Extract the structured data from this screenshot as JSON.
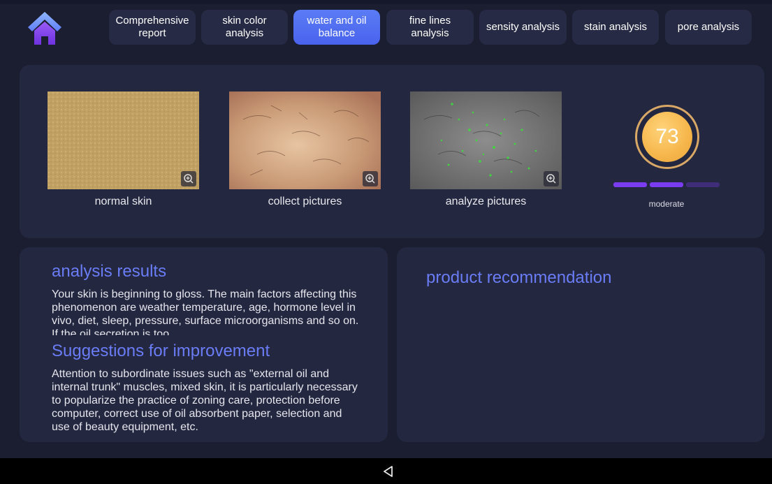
{
  "tabs": [
    {
      "label": "Comprehensive\nreport",
      "active": false
    },
    {
      "label": "skin color\nanalysis",
      "active": false
    },
    {
      "label": "water and oil\nbalance",
      "active": true
    },
    {
      "label": "fine lines\nanalysis",
      "active": false
    },
    {
      "label": "sensity analysis",
      "active": false
    },
    {
      "label": "stain analysis",
      "active": false
    },
    {
      "label": "pore analysis",
      "active": false
    }
  ],
  "images": {
    "normal": {
      "caption": "normal skin"
    },
    "collect": {
      "caption": "collect pictures"
    },
    "analyze": {
      "caption": "analyze pictures"
    }
  },
  "score": {
    "value": "73",
    "level_label": "moderate",
    "level_filled": 2,
    "level_total": 3
  },
  "analysis": {
    "title": "analysis results",
    "text": "Your skin is beginning to gloss. The main factors affecting this phenomenon are weather temperature, age, hormone level in vivo, diet, sleep, pressure, surface microorganisms and so on. If the oil secretion is too"
  },
  "suggestions": {
    "title": "Suggestions for improvement",
    "text": "Attention to subordinate issues such as \"external oil and internal trunk\" muscles, mixed skin, it is particularly necessary to popularize the practice of zoning care, protection before computer, correct use of oil absorbent paper, selection and use of beauty equipment, etc."
  },
  "recommendation": {
    "title": "product recommendation"
  },
  "colors": {
    "background": "#1b1d30",
    "panel": "#23273f",
    "accent": "#6a7cf6",
    "active_tab": "#4f6cf2",
    "level_on": "#7a3cf0",
    "level_off": "#3f2d7a",
    "score": "#f6b64b"
  },
  "icons": {
    "home": "home-icon",
    "zoom": "zoom-in-icon",
    "back": "back-triangle-icon"
  }
}
